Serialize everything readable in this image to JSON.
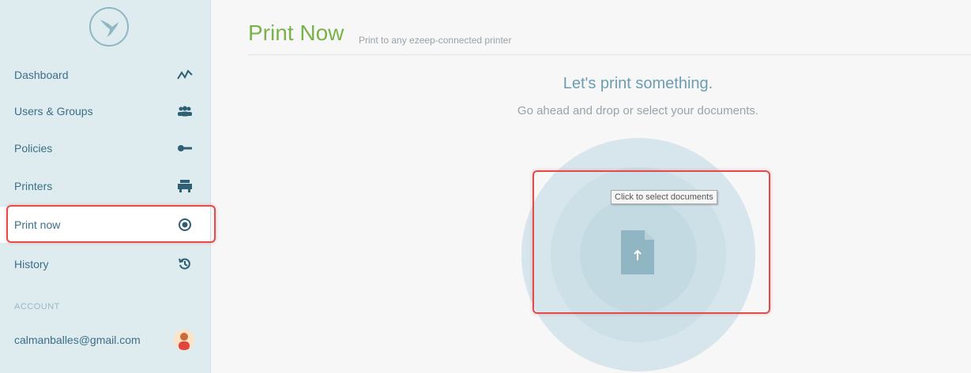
{
  "sidebar": {
    "logo_icon": "hummingbird-logo-icon",
    "items": [
      {
        "label": "Dashboard",
        "icon": "activity-icon"
      },
      {
        "label": "Users & Groups",
        "icon": "users-icon"
      },
      {
        "label": "Policies",
        "icon": "key-icon"
      },
      {
        "label": "Printers",
        "icon": "printer-icon"
      },
      {
        "label": "Print now",
        "icon": "target-icon",
        "active": true
      },
      {
        "label": "History",
        "icon": "history-icon"
      }
    ],
    "account_section": "ACCOUNT",
    "account_email": "calmanballes@gmail.com"
  },
  "header": {
    "title": "Print Now",
    "subtitle": "Print to any ezeep-connected printer"
  },
  "main": {
    "heading": "Let's print something.",
    "subheading": "Go ahead and drop or select your documents.",
    "tooltip": "Click to select documents",
    "upload_icon": "upload-document-icon"
  },
  "colors": {
    "accent_green": "#7ab24a",
    "link_blue": "#3a6f88",
    "highlight_red": "#e34b4b",
    "sidebar_bg": "#dfecef"
  }
}
